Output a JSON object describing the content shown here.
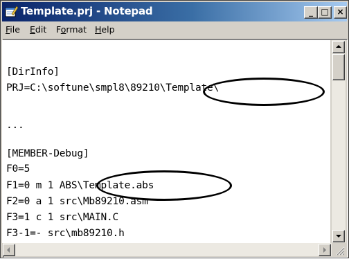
{
  "window": {
    "title": "Template.prj - Notepad"
  },
  "caption_buttons": {
    "minimize": "_",
    "maximize": "□",
    "close": "×"
  },
  "menu": {
    "items": [
      {
        "pre": "",
        "key": "F",
        "post": "ile"
      },
      {
        "pre": "",
        "key": "E",
        "post": "dit"
      },
      {
        "pre": "F",
        "key": "o",
        "post": "rmat"
      },
      {
        "pre": "",
        "key": "H",
        "post": "elp"
      }
    ]
  },
  "editor": {
    "lines": [
      "",
      "[DirInfo]",
      "PRJ=C:\\softune\\smpl8\\89210\\Template\\",
      "",
      "...",
      "",
      "[MEMBER-Debug]",
      "F0=5",
      "F1=0 m 1 ABS\\Template.abs",
      "F2=0 a 1 src\\Mb89210.asm",
      "F3=1 c 1 src\\MAIN.C",
      "F3-1=- src\\mb89210.h"
    ]
  },
  "icons": {
    "app": "notepad-icon",
    "vscroll_up": "arrow-up-icon",
    "vscroll_down": "arrow-down-icon",
    "hscroll_left": "arrow-left-icon",
    "hscroll_right": "arrow-right-icon"
  },
  "colors": {
    "titlebar_start": "#0a246a",
    "titlebar_end": "#a6caf0",
    "chrome": "#d4d0c8",
    "annotation": "#000000"
  }
}
